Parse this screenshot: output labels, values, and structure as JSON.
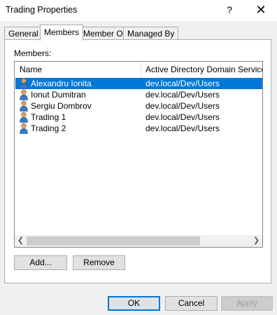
{
  "window": {
    "title": "Trading Properties",
    "help_label": "?",
    "close_label": "✕"
  },
  "tabs": [
    {
      "label": "General",
      "active": false
    },
    {
      "label": "Members",
      "active": true
    },
    {
      "label": "Member Of",
      "active": false
    },
    {
      "label": "Managed By",
      "active": false
    }
  ],
  "members": {
    "label": "Members:",
    "columns": [
      "Name",
      "Active Directory Domain Services F"
    ],
    "rows": [
      {
        "name": "Alexandru Ionita",
        "path": "dev.local/Dev/Users",
        "selected": true
      },
      {
        "name": "Ionut Dumitran",
        "path": "dev.local/Dev/Users",
        "selected": false
      },
      {
        "name": "Sergiu Dombrov",
        "path": "dev.local/Dev/Users",
        "selected": false
      },
      {
        "name": "Trading 1",
        "path": "dev.local/Dev/Users",
        "selected": false
      },
      {
        "name": "Trading 2",
        "path": "dev.local/Dev/Users",
        "selected": false
      }
    ],
    "scroll_left": "❮",
    "scroll_right": "❯",
    "row_icon": "user-icon"
  },
  "actions": {
    "add": "Add...",
    "remove": "Remove"
  },
  "footer": {
    "ok": "OK",
    "cancel": "Cancel",
    "apply": "Apply",
    "apply_enabled": false
  },
  "colors": {
    "selection": "#0078d7",
    "default_button_border": "#0078d7"
  }
}
